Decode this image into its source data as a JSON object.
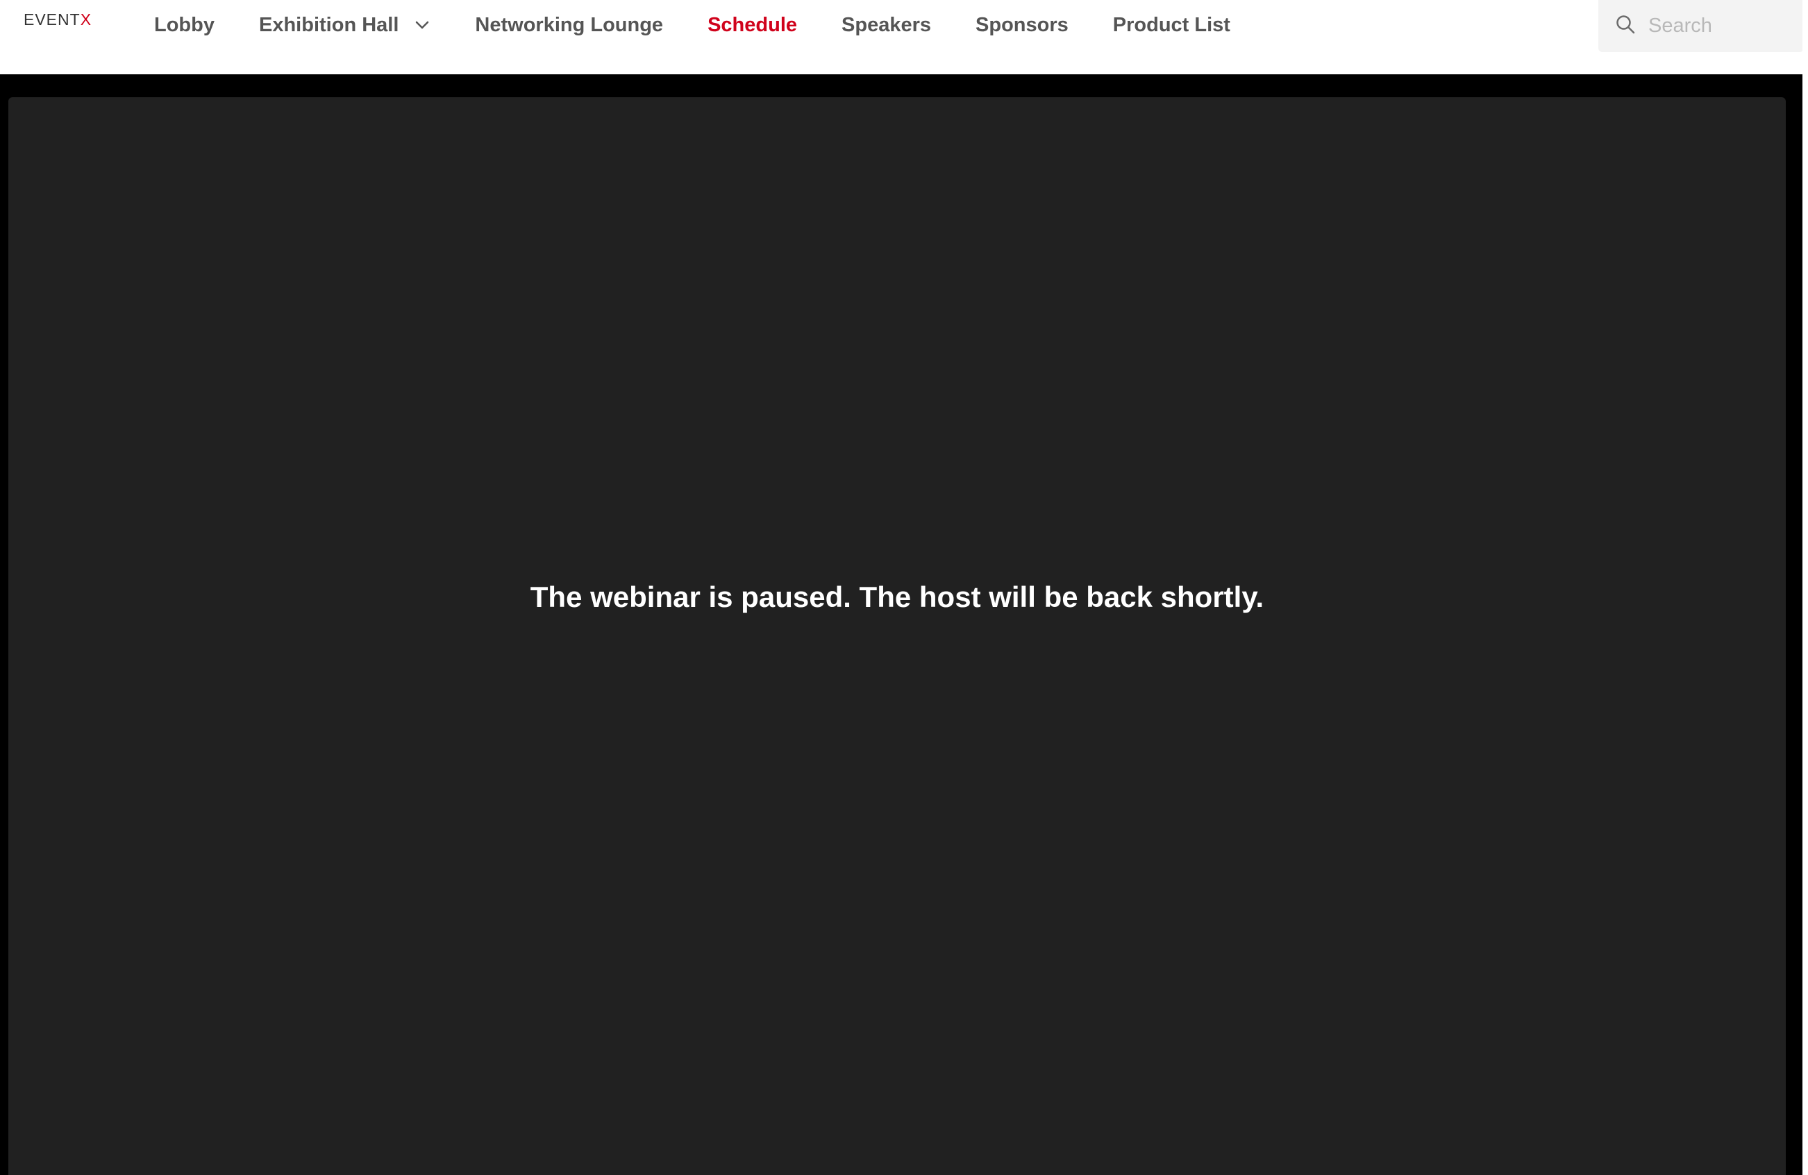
{
  "app": {
    "logo_text_main": "EVENT",
    "logo_text_accent": "X"
  },
  "nav": {
    "items": [
      {
        "label": "Lobby",
        "active": false,
        "has_dropdown": false
      },
      {
        "label": "Exhibition Hall",
        "active": false,
        "has_dropdown": true
      },
      {
        "label": "Networking Lounge",
        "active": false,
        "has_dropdown": false
      },
      {
        "label": "Schedule",
        "active": true,
        "has_dropdown": false
      },
      {
        "label": "Speakers",
        "active": false,
        "has_dropdown": false
      },
      {
        "label": "Sponsors",
        "active": false,
        "has_dropdown": false
      },
      {
        "label": "Product List",
        "active": false,
        "has_dropdown": false
      }
    ]
  },
  "search": {
    "placeholder": "Search",
    "value": "",
    "icon": "search-icon"
  },
  "webinar": {
    "status_message": "The webinar is paused. The host will be back shortly."
  },
  "colors": {
    "accent": "#d0021b",
    "nav_text": "#555555",
    "stage_bg": "#212121",
    "page_bg": "#000000"
  }
}
